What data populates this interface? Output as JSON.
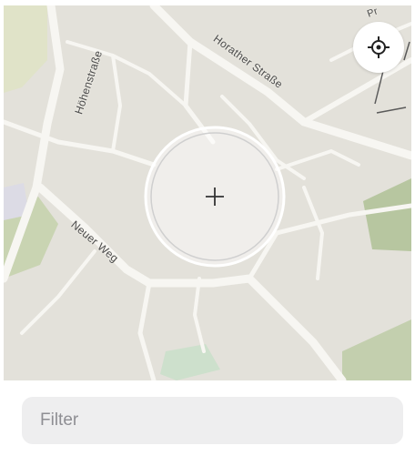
{
  "map": {
    "streets": [
      {
        "id": "hoehenstrasse",
        "label": "Höhenstraße"
      },
      {
        "id": "horather-strasse",
        "label": "Horather Straße"
      },
      {
        "id": "neuer-weg",
        "label": "Neuer Weg"
      },
      {
        "id": "edge-label",
        "label": "Pr"
      }
    ],
    "colors": {
      "land": "#e3e1da",
      "road": "#f7f6f2",
      "green": "#b9c7a4",
      "reticle_ring": "#ffffff"
    }
  },
  "controls": {
    "locate_icon": "crosshair-target-icon",
    "center_icon": "plus-crosshair-icon"
  },
  "filter": {
    "placeholder": "Filter",
    "value": ""
  }
}
